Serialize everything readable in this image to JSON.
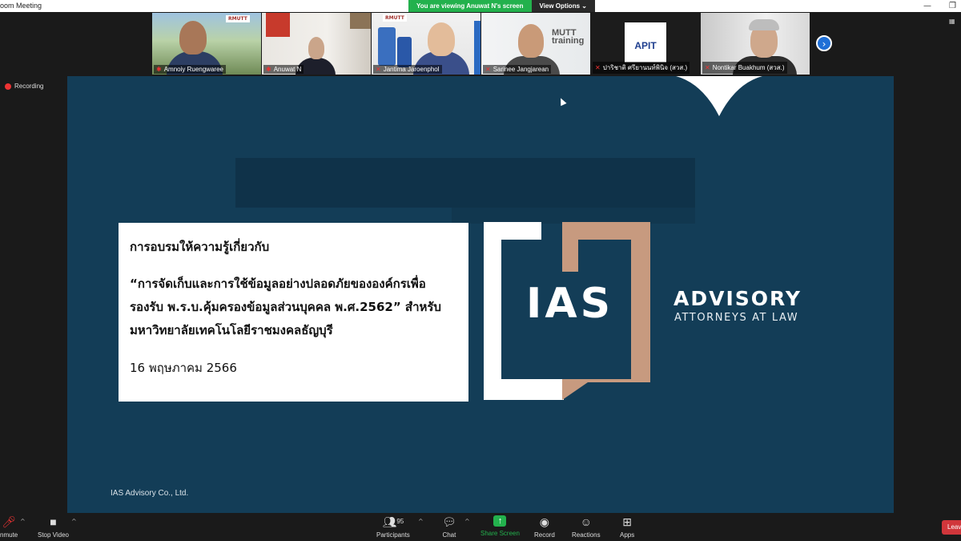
{
  "window": {
    "title": "oom Meeting",
    "controls": [
      "—",
      "❐"
    ]
  },
  "banner": {
    "message": "You are viewing Anuwat N's screen",
    "options": "View Options ⌄"
  },
  "participants_strip": [
    {
      "name": "Amnoiy Ruengwaree",
      "muted": false
    },
    {
      "name": "Anuwat N",
      "muted": false
    },
    {
      "name": "Jantima Jaroenphol",
      "muted": true
    },
    {
      "name": "Sarinee Jangjarean",
      "muted": true
    },
    {
      "name": "ปาริชาติ ศรียานนท์พินิจ (สวส.)",
      "muted": true
    },
    {
      "name": "Nontikar Buakhum  (สวส.)",
      "muted": true
    }
  ],
  "tile_labels": {
    "rmutt1": "RMUTT",
    "mutt_training": "MUTT\ntraining",
    "apit": "APIT"
  },
  "recording_label": "Recording",
  "slide": {
    "heading": "การอบรมให้ความรู้เกี่ยวกับ",
    "body_lines": [
      "“การจัดเก็บและการใช้ข้อมูลอย่างปลอดภัยขององค์กรเพื่อ",
      "รองรับ พ.ร.บ.คุ้มครองข้อมูลส่วนบุคคล พ.ศ.2562” สำหรับ",
      "มหาวิทยาลัยเทคโนโลยีราชมงคลธัญบุรี"
    ],
    "date": "16 พฤษภาคม 2566",
    "logo_text": "IAS",
    "brand_title": "ADVISORY",
    "brand_subtitle": "ATTORNEYS AT LAW",
    "footer": "IAS Advisory Co., Ltd.",
    "colors": {
      "background": "#133d57",
      "accent": "#c79a7f"
    }
  },
  "toolbar": {
    "unmute": "nmute",
    "stop_video": "Stop Video",
    "participants": "Participants",
    "participants_count": "95",
    "chat": "Chat",
    "share_screen": "Share Screen",
    "record": "Record",
    "reactions": "Reactions",
    "apps": "Apps",
    "leave": "Leav"
  }
}
